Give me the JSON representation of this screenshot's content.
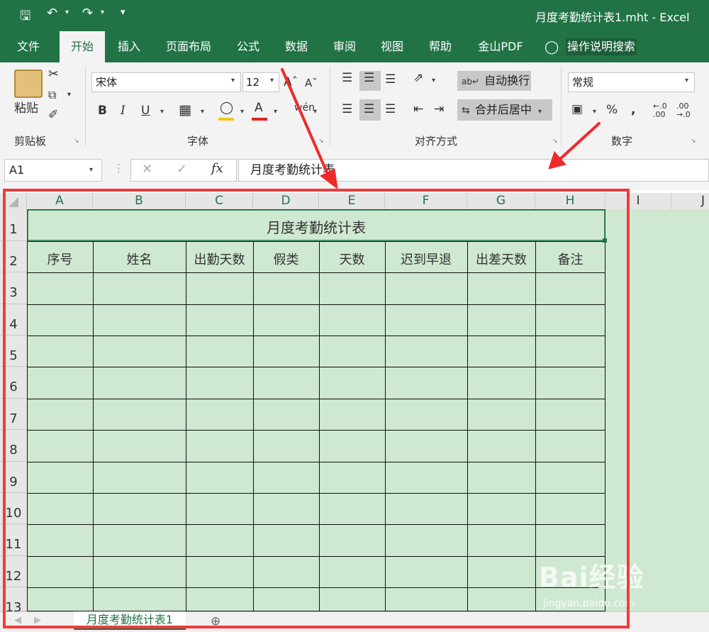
{
  "window": {
    "title": "月度考勤统计表1.mht  -  Excel"
  },
  "quick_access": {
    "save_icon": "save-icon",
    "undo_icon": "undo-icon",
    "redo_icon": "redo-icon"
  },
  "ribbon_tabs": [
    "文件",
    "开始",
    "插入",
    "页面布局",
    "公式",
    "数据",
    "审阅",
    "视图",
    "帮助",
    "金山PDF"
  ],
  "tell_me": "操作说明搜索",
  "clipboard": {
    "paste_label": "粘贴",
    "group_name": "剪贴板"
  },
  "font": {
    "name": "宋体",
    "size": "12",
    "bold": "B",
    "italic": "I",
    "underline": "U",
    "group_name": "字体"
  },
  "alignment": {
    "wrap_text": "自动换行",
    "merge_center": "合并后居中",
    "group_name": "对齐方式"
  },
  "number": {
    "format": "常规",
    "group_name": "数字"
  },
  "formula_bar": {
    "name_box": "A1",
    "formula": "月度考勤统计表",
    "fx": "fx"
  },
  "columns": [
    "A",
    "B",
    "C",
    "D",
    "E",
    "F",
    "G",
    "H",
    "I",
    "J"
  ],
  "rows": [
    "1",
    "2",
    "3",
    "4",
    "5",
    "6",
    "7",
    "8",
    "9",
    "10",
    "11",
    "12",
    "13"
  ],
  "table": {
    "title": "月度考勤统计表",
    "headers": [
      "序号",
      "姓名",
      "出勤天数",
      "假类",
      "天数",
      "迟到早退",
      "出差天数",
      "备注"
    ]
  },
  "sheet_tabs": [
    "月度考勤统计表1"
  ],
  "watermark": {
    "text": "Bai经验",
    "url": "jingyan.baidu.com"
  },
  "colors": {
    "excel_green": "#217346",
    "sheet_fill": "#cfe8d1",
    "annotation_red": "#f23b3b"
  }
}
